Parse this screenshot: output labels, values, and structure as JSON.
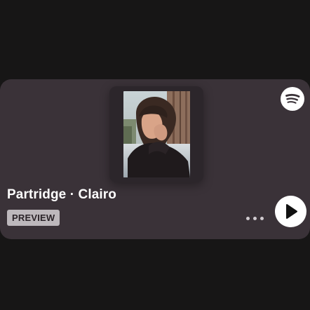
{
  "track": {
    "title_line": "Partridge · Clairo",
    "badge": "PREVIEW"
  },
  "icons": {
    "brand": "spotify-logo-icon",
    "more": "more-options-icon",
    "play": "play-icon"
  },
  "colors": {
    "page_background": "#171616",
    "card_background": "#3a3238",
    "badge_background": "#bdb8bc",
    "text": "#ffffff"
  }
}
